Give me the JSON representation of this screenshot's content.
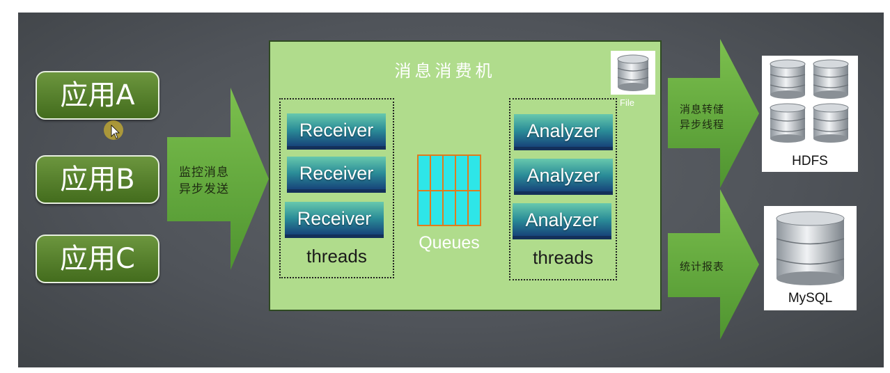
{
  "apps": [
    {
      "label": "应用A"
    },
    {
      "label": "应用B"
    },
    {
      "label": "应用C"
    }
  ],
  "left_arrow": {
    "line1": "监控消息",
    "line2": "异步发送"
  },
  "consumer": {
    "title": "消息消费机",
    "receivers": [
      "Receiver",
      "Receiver",
      "Receiver"
    ],
    "receiver_threads_label": "threads",
    "queues_label": "Queues",
    "analyzers": [
      "Analyzer",
      "Analyzer",
      "Analyzer"
    ],
    "analyzer_threads_label": "threads",
    "file_label": "File"
  },
  "right_arrows": {
    "top": {
      "line1": "消息转储",
      "line2": "异步线程"
    },
    "bottom": {
      "line1": "统计报表"
    }
  },
  "storage": {
    "hdfs_label": "HDFS",
    "mysql_label": "MySQL"
  },
  "colors": {
    "app_green": "#436c1d",
    "arrow_green": "#5ea93a",
    "panel_green": "#b0dc8c",
    "queue_cell": "#2ee6e8",
    "queue_border": "#e07b1c"
  }
}
